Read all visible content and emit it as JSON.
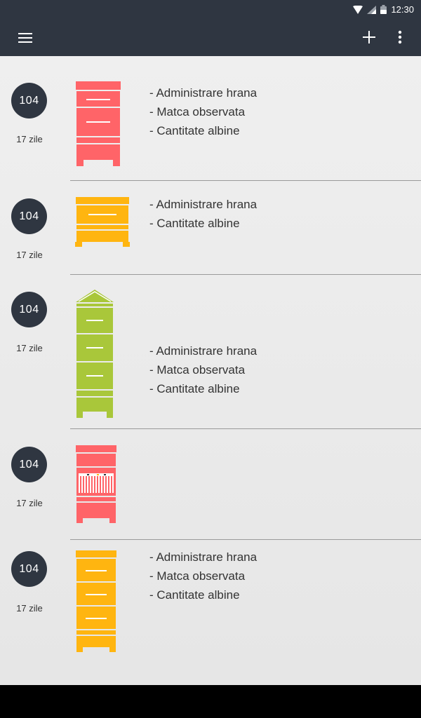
{
  "status_bar": {
    "time": "12:30",
    "icons": [
      "wifi-icon",
      "signal-icon",
      "battery-icon"
    ]
  },
  "app_bar": {
    "icons": [
      "menu-icon",
      "add-icon",
      "more-vert-icon"
    ]
  },
  "colors": {
    "red": "#ff6468",
    "orange": "#ffb510",
    "green": "#a9c73a",
    "dark": "#2f3641"
  },
  "hives": [
    {
      "number": "104",
      "days": "17 zile",
      "tasks": [
        "- Administrare hrana",
        "- Matca observata",
        "- Cantitate albine"
      ]
    },
    {
      "number": "104",
      "days": "17 zile",
      "tasks": [
        "- Administrare hrana",
        "- Cantitate albine"
      ]
    },
    {
      "number": "104",
      "days": "17 zile",
      "tasks": [
        "- Administrare hrana",
        "- Matca observata",
        "- Cantitate albine"
      ]
    },
    {
      "number": "104",
      "days": "17 zile",
      "tasks": []
    },
    {
      "number": "104",
      "days": "17 zile",
      "tasks": [
        "- Administrare hrana",
        "- Matca observata",
        "- Cantitate albine"
      ]
    }
  ]
}
